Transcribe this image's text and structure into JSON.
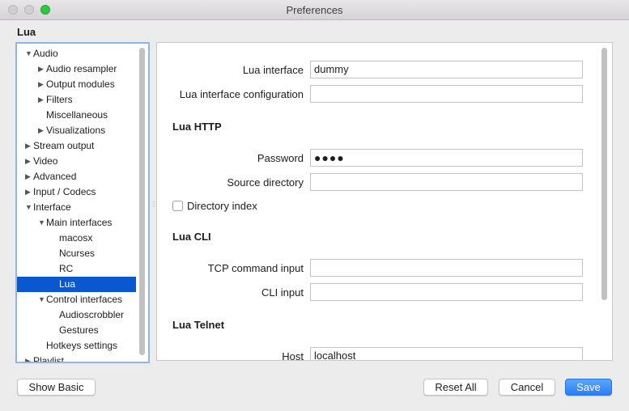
{
  "window": {
    "title": "Preferences"
  },
  "page": {
    "section_title": "Lua"
  },
  "tree": {
    "items": [
      {
        "label": "Audio",
        "arrow": "▼"
      },
      {
        "label": "Audio resampler",
        "arrow": "▶"
      },
      {
        "label": "Output modules",
        "arrow": "▶"
      },
      {
        "label": "Filters",
        "arrow": "▶"
      },
      {
        "label": "Miscellaneous",
        "arrow": ""
      },
      {
        "label": "Visualizations",
        "arrow": "▶"
      },
      {
        "label": "Stream output",
        "arrow": "▶"
      },
      {
        "label": "Video",
        "arrow": "▶"
      },
      {
        "label": "Advanced",
        "arrow": "▶"
      },
      {
        "label": "Input / Codecs",
        "arrow": "▶"
      },
      {
        "label": "Interface",
        "arrow": "▼"
      },
      {
        "label": "Main interfaces",
        "arrow": "▼"
      },
      {
        "label": "macosx",
        "arrow": ""
      },
      {
        "label": "Ncurses",
        "arrow": ""
      },
      {
        "label": "RC",
        "arrow": ""
      },
      {
        "label": "Lua",
        "arrow": "",
        "selected": true
      },
      {
        "label": "Control interfaces",
        "arrow": "▼"
      },
      {
        "label": "Audioscrobbler",
        "arrow": ""
      },
      {
        "label": "Gestures",
        "arrow": ""
      },
      {
        "label": "Hotkeys settings",
        "arrow": ""
      },
      {
        "label": "Playlist",
        "arrow": "▶"
      }
    ]
  },
  "settings": {
    "lua_interface": {
      "label": "Lua interface",
      "value": "dummy"
    },
    "lua_interface_config": {
      "label": "Lua interface configuration",
      "value": ""
    },
    "lua_http": {
      "heading": "Lua HTTP",
      "password": {
        "label": "Password",
        "value": "●●●●"
      },
      "source_directory": {
        "label": "Source directory",
        "value": ""
      },
      "directory_index": {
        "label": "Directory index",
        "checked": false
      }
    },
    "lua_cli": {
      "heading": "Lua CLI",
      "tcp_command_input": {
        "label": "TCP command input",
        "value": ""
      },
      "cli_input": {
        "label": "CLI input",
        "value": ""
      }
    },
    "lua_telnet": {
      "heading": "Lua Telnet",
      "host": {
        "label": "Host",
        "value": "localhost"
      }
    }
  },
  "buttons": {
    "show_basic": "Show Basic",
    "reset_all": "Reset All",
    "cancel": "Cancel",
    "save": "Save"
  },
  "colors": {
    "selection": "#0a58d0",
    "accent": "#2a7ef8"
  }
}
